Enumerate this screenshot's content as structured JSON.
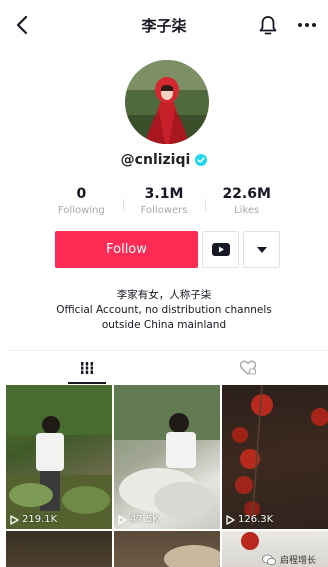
{
  "header": {
    "title": "李子柒",
    "icons": [
      "back-arrow-icon",
      "bell-icon",
      "more-icon"
    ]
  },
  "profile": {
    "username": "@cnliziqi",
    "verified": true,
    "stats": [
      {
        "value": "0",
        "label": "Following"
      },
      {
        "value": "3.1M",
        "label": "Followers"
      },
      {
        "value": "22.6M",
        "label": "Likes"
      }
    ],
    "follow_label": "Follow",
    "bio_lines": [
      "李家有女，人称子柒",
      "Official Account,  no distribution channels",
      "outside China mainland"
    ]
  },
  "tabs": {
    "videos_icon": "grid-icon",
    "liked_icon": "heart-icon"
  },
  "videos": [
    {
      "views": "219.1K"
    },
    {
      "views": "47.5K"
    },
    {
      "views": "126.3K"
    }
  ],
  "watermark": {
    "text": "启程增长"
  },
  "colors": {
    "accent": "#fe2c55",
    "verified": "#20d5ec",
    "muted_text": "#a7a8ad"
  }
}
